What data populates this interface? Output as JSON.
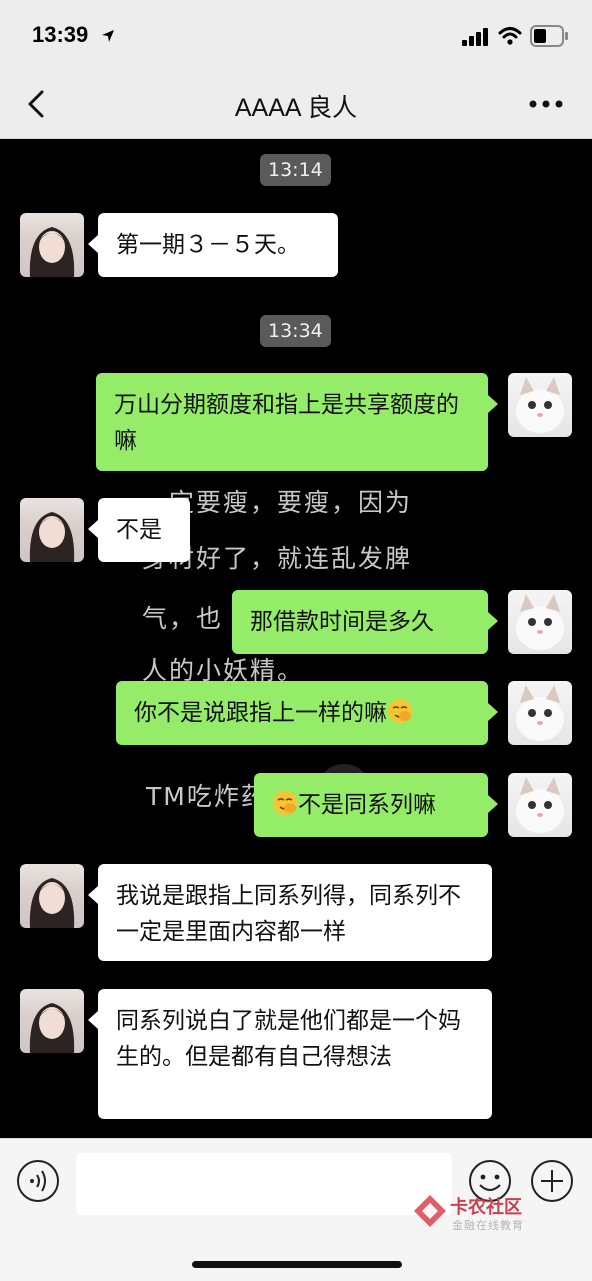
{
  "status_bar": {
    "time": "13:39"
  },
  "header": {
    "title": "AAAA 良人"
  },
  "wallpaper_lines": [
    "一定要瘦，要瘦，因为",
    "身材好了，就连乱发脾",
    "气，也",
    "人的小妖精。",
    "TM吃炸药"
  ],
  "timestamps": [
    "13:14",
    "13:34"
  ],
  "messages": [
    {
      "side": "in",
      "text": "第一期３－５天。"
    },
    {
      "side": "out",
      "text": "万山分期额度和指上是共享额度的嘛"
    },
    {
      "side": "in",
      "text": "不是"
    },
    {
      "side": "out",
      "text": "那借款时间是多久"
    },
    {
      "side": "out",
      "text": "你不是说跟指上一样的嘛",
      "emoji_after": "facepalm-emoji"
    },
    {
      "side": "out",
      "text": "不是同系列嘛",
      "emoji_before": "facepalm-emoji"
    },
    {
      "side": "in",
      "text": "我说是跟指上同系列得，同系列不一定是里面内容都一样"
    },
    {
      "side": "in",
      "text": "同系列说白了就是他们都是一个妈生的。但是都有自己得想法"
    }
  ],
  "input_bar": {
    "placeholder": ""
  },
  "watermark": {
    "main": "卡农社区",
    "sub": "金融在线教育"
  },
  "colors": {
    "incoming_bubble": "#ffffff",
    "outgoing_bubble": "#95ec69",
    "chat_background": "#000000",
    "header_background": "#ededed",
    "timestamp_chip": "#5a5a5a"
  }
}
